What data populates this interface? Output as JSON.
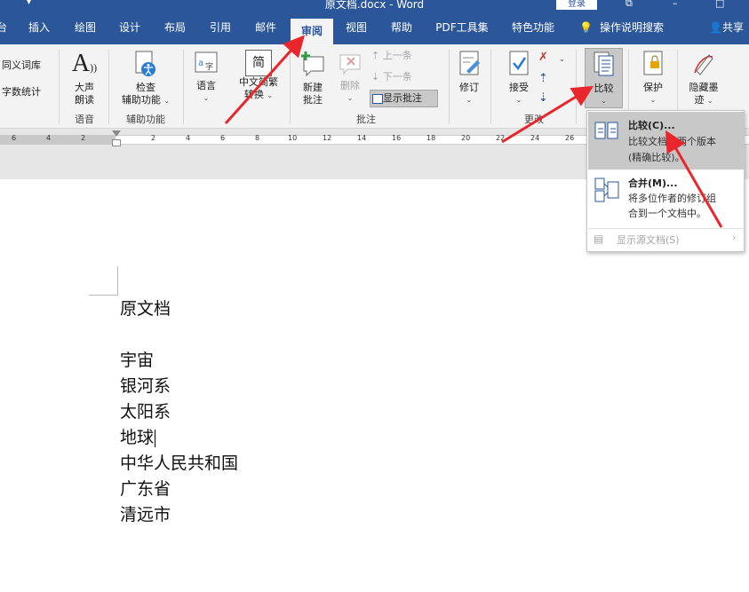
{
  "titlebar": {
    "qa_label": "▾",
    "title": "原文档.docx  -  Word",
    "login": "登录",
    "icons": [
      "ribbon-display-icon",
      "minimize-icon",
      "maximize-icon"
    ]
  },
  "tabs": [
    "台",
    "插入",
    "绘图",
    "设计",
    "布局",
    "引用",
    "邮件",
    "审阅",
    "视图",
    "帮助",
    "PDF工具集",
    "特色功能"
  ],
  "active_tab": "审阅",
  "tellme": "操作说明搜索",
  "share": "共享",
  "ribbon": {
    "proofing": {
      "thesaurus": "同义词库",
      "wordcount": "字数统计"
    },
    "speech": {
      "readaloud_line1": "大声",
      "readaloud_line2": "朗读",
      "group": "语音"
    },
    "accessibility": {
      "check_line1": "检查",
      "check_line2": "辅助功能",
      "group": "辅助功能"
    },
    "language": {
      "label": "语言",
      "convert_line1": "中文简繁",
      "convert_line2": "转换",
      "convert_icon_text": "简"
    },
    "comments": {
      "new_line1": "新建",
      "new_line2": "批注",
      "delete": "删除",
      "prev": "上一条",
      "next": "下一条",
      "show": "显示批注",
      "group": "批注"
    },
    "tracking": {
      "track": "修订"
    },
    "changes": {
      "accept": "接受",
      "group": "更改"
    },
    "compare": {
      "label": "比较"
    },
    "protect": {
      "label": "保护"
    },
    "ink": {
      "line1": "隐藏墨",
      "line2": "迹"
    }
  },
  "ruler": {
    "ticks": [
      "6",
      "4",
      "2",
      "2",
      "4",
      "6",
      "8",
      "10",
      "12",
      "14",
      "16",
      "18",
      "20",
      "22",
      "24",
      "26"
    ]
  },
  "document": {
    "lines": [
      "原文档",
      "宇宙",
      "银河系",
      "太阳系",
      "地球",
      "中华人民共和国",
      "广东省",
      "清远市"
    ]
  },
  "menu": {
    "compare": {
      "title": "比较(C)...",
      "desc1": "比较文档的两个版本",
      "desc2": "(精确比较)。"
    },
    "combine": {
      "title": "合并(M)...",
      "desc1": "将多位作者的修订组",
      "desc2": "合到一个文档中。"
    },
    "show_source": "显示源文档(S)"
  },
  "colors": {
    "word_blue": "#2b579a",
    "arrow_red": "#e8262b",
    "ribbon_bg": "#f3f3f3"
  }
}
